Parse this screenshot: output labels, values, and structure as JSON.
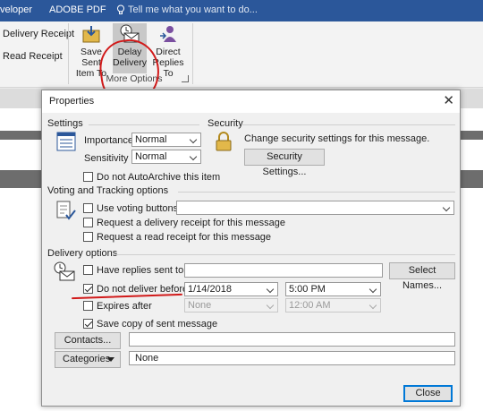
{
  "topbar": {
    "tab_developer": "veloper",
    "tab_adobe": "ADOBE PDF",
    "tell_me_placeholder": "Tell me what you want to do..."
  },
  "ribbon": {
    "left_items": [
      "Delivery Receipt",
      "Read Receipt"
    ],
    "save_sent_item": "Save Sent Item To",
    "delay_delivery": "Delay Delivery",
    "direct_replies": "Direct Replies To",
    "group_label": "More Options"
  },
  "dialog": {
    "title": "Properties",
    "close": "✕",
    "settings": {
      "heading": "Settings",
      "importance_label": "Importance",
      "importance_value": "Normal",
      "sensitivity_label": "Sensitivity",
      "sensitivity_value": "Normal",
      "no_autoarchive": "Do not AutoArchive this item"
    },
    "security": {
      "heading": "Security",
      "text": "Change security settings for this message.",
      "button": "Security Settings..."
    },
    "voting": {
      "heading": "Voting and Tracking options",
      "use_voting": "Use voting buttons",
      "delivery_receipt": "Request a delivery receipt for this message",
      "read_receipt": "Request a read receipt for this message"
    },
    "delivery": {
      "heading": "Delivery options",
      "have_replies": "Have replies sent to",
      "select_names": "Select Names...",
      "do_not_deliver": "Do not deliver before",
      "deliver_date": "1/14/2018",
      "deliver_time": "5:00 PM",
      "expires_after": "Expires after",
      "expires_date": "None",
      "expires_time": "12:00 AM",
      "save_copy": "Save copy of sent message"
    },
    "contacts_button": "Contacts...",
    "categories_button": "Categories",
    "categories_value": "None",
    "close_button": "Close"
  }
}
